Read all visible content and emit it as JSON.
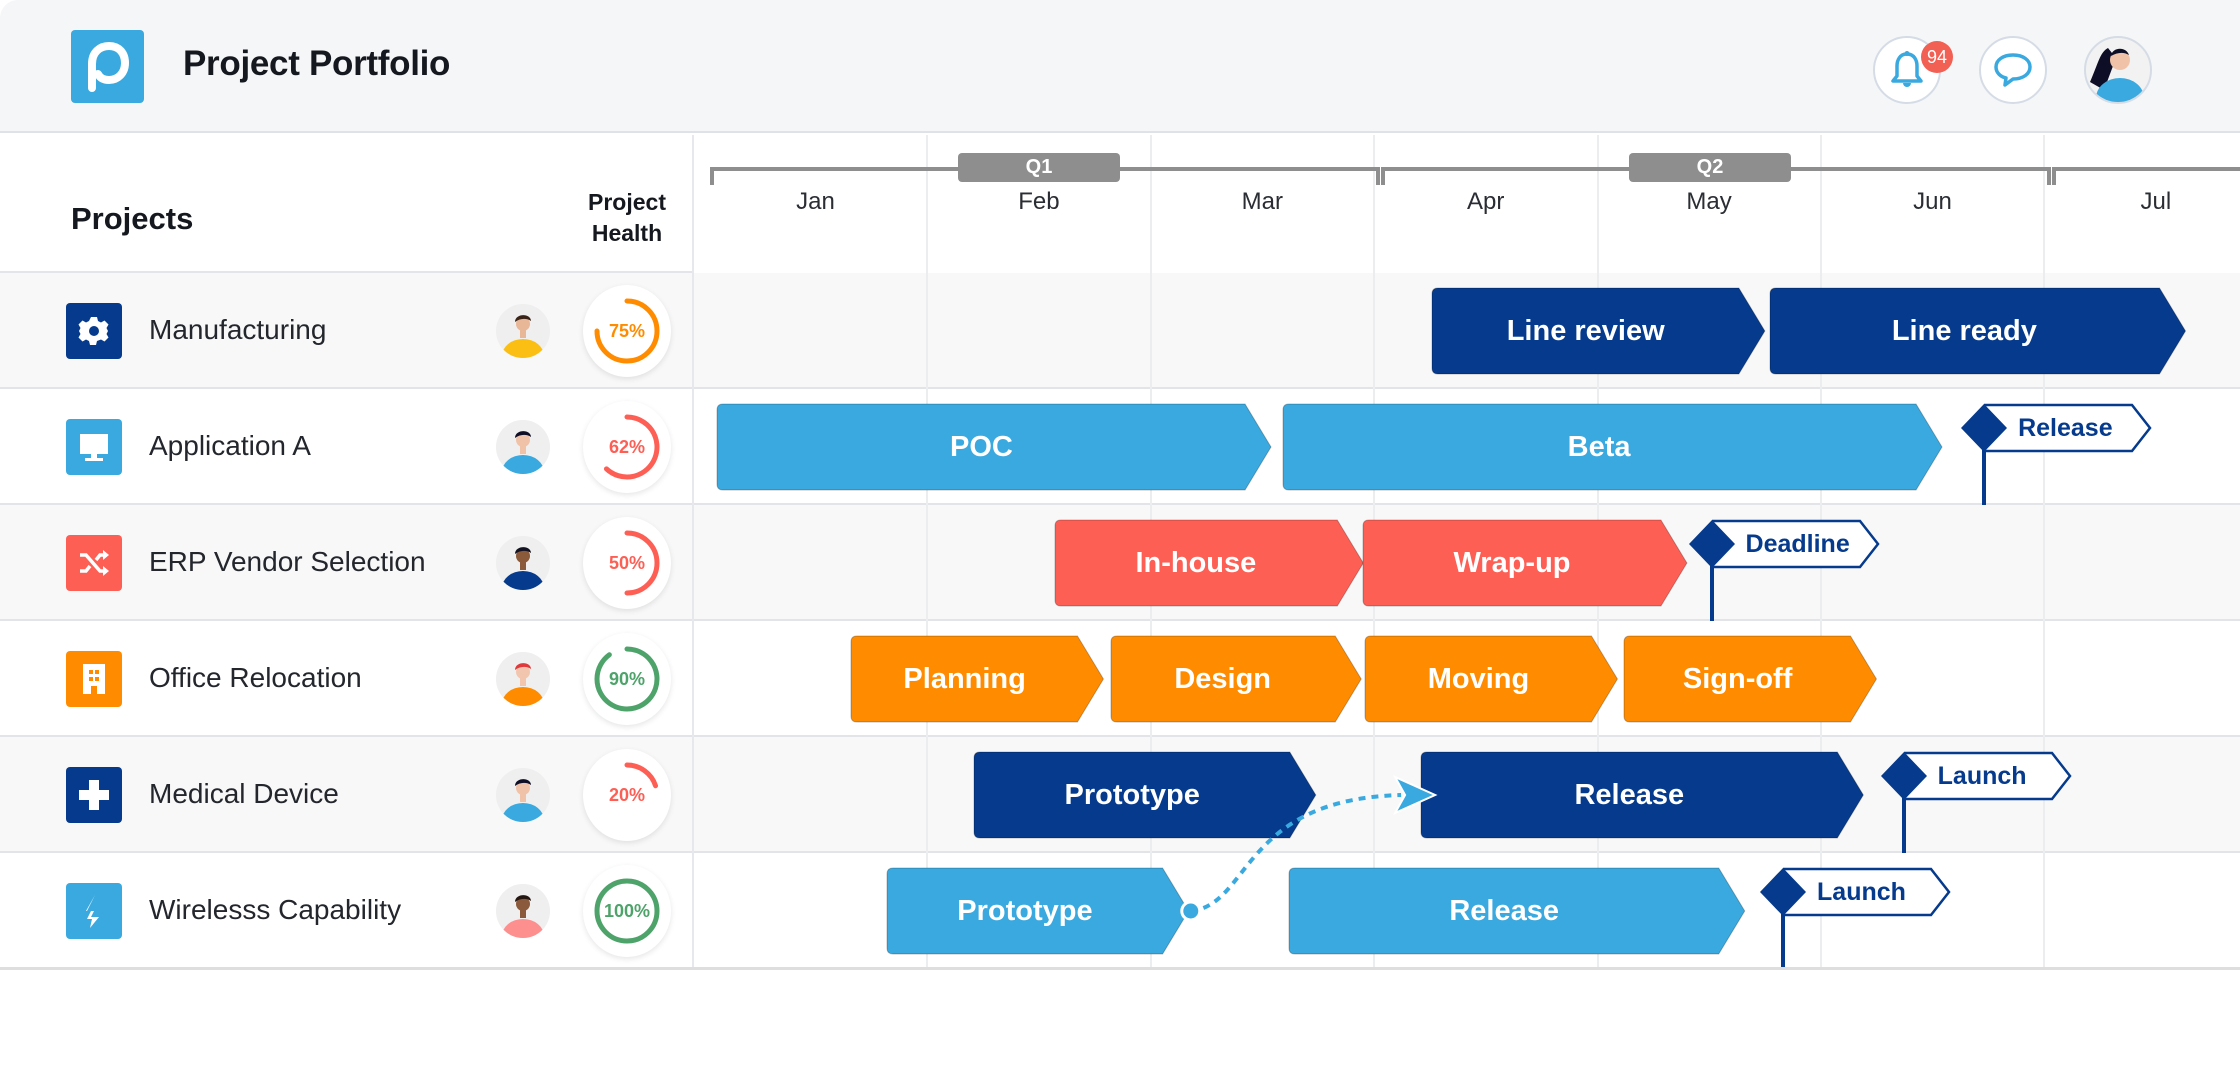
{
  "header": {
    "app_title": "Project Portfolio",
    "logo_letter": "p",
    "notifications_count": "94",
    "icons": {
      "logo": "portfolio-logo-icon",
      "notifications": "bell-icon",
      "messages": "chat-bubble-icon",
      "user": "user-avatar"
    }
  },
  "columns": {
    "projects_label": "Projects",
    "health_label_line1": "Project",
    "health_label_line2": "Health"
  },
  "timeline": {
    "quarters": [
      {
        "label": "Q1"
      },
      {
        "label": "Q2"
      }
    ],
    "months": [
      "Jan",
      "Feb",
      "Mar",
      "Apr",
      "May",
      "Jun",
      "Jul"
    ]
  },
  "colors": {
    "navy": "#053a8c",
    "sky": "#39a9df",
    "coral": "#fe5f55",
    "orange": "#ff8c00",
    "green": "#4ea36a",
    "quarter_gray": "#8e8e8e"
  },
  "projects": [
    {
      "name": "Manufacturing",
      "icon": "gear-icon",
      "icon_color": "#053a8c",
      "owner_shirt": "#fbbf14",
      "owner_hair": "#3a2418",
      "owner_skin": "#e8b797",
      "health": "75%",
      "health_value": 0.75,
      "health_color": "#ff8c00",
      "tasks": [
        {
          "label": "Line review",
          "start": 3.26,
          "end": 4.75,
          "color": "#053a8c"
        },
        {
          "label": "Line ready",
          "start": 4.77,
          "end": 6.63,
          "color": "#053a8c"
        }
      ],
      "milestones": []
    },
    {
      "name": "Application A",
      "icon": "monitor-icon",
      "icon_color": "#39a9df",
      "owner_shirt": "#39a9df",
      "owner_hair": "#0e0e26",
      "owner_skin": "#f0c3a8",
      "health": "62%",
      "health_value": 0.62,
      "health_color": "#fe5f55",
      "tasks": [
        {
          "label": "POC",
          "start": 0.06,
          "end": 2.54,
          "color": "#39a9df"
        },
        {
          "label": "Beta",
          "start": 2.59,
          "end": 5.54,
          "color": "#39a9df"
        }
      ],
      "milestones": [
        {
          "label": "Release",
          "at": 5.73
        }
      ]
    },
    {
      "name": "ERP Vendor Selection",
      "icon": "shuffle-icon",
      "icon_color": "#fe5f55",
      "owner_shirt": "#053a8c",
      "owner_hair": "#111122",
      "owner_skin": "#8a5a3a",
      "health": "50%",
      "health_value": 0.5,
      "health_color": "#fe5f55",
      "tasks": [
        {
          "label": "In-house",
          "start": 1.57,
          "end": 2.95,
          "color": "#fe5f55"
        },
        {
          "label": "Wrap-up",
          "start": 2.95,
          "end": 4.4,
          "color": "#fe5f55"
        }
      ],
      "milestones": [
        {
          "label": "Deadline",
          "at": 4.51
        }
      ]
    },
    {
      "name": "Office Relocation",
      "icon": "building-icon",
      "icon_color": "#ff8c00",
      "owner_shirt": "#ff8c00",
      "owner_hair": "#e0393b",
      "owner_skin": "#f2c6ae",
      "health": "90%",
      "health_value": 0.9,
      "health_color": "#4ea36a",
      "tasks": [
        {
          "label": "Planning",
          "start": 0.66,
          "end": 1.79,
          "color": "#ff8c00"
        },
        {
          "label": "Design",
          "start": 1.82,
          "end": 2.94,
          "color": "#ff8c00"
        },
        {
          "label": "Moving",
          "start": 2.96,
          "end": 4.09,
          "color": "#ff8c00"
        },
        {
          "label": "Sign-off",
          "start": 4.12,
          "end": 5.25,
          "color": "#ff8c00"
        }
      ],
      "milestones": []
    },
    {
      "name": "Medical Device",
      "icon": "plus-cross-icon",
      "icon_color": "#053a8c",
      "owner_shirt": "#39a9df",
      "owner_hair": "#0e0e26",
      "owner_skin": "#f0c3a8",
      "health": "20%",
      "health_value": 0.2,
      "health_color": "#fe5f55",
      "tasks": [
        {
          "label": "Prototype",
          "start": 1.21,
          "end": 2.74,
          "color": "#053a8c"
        },
        {
          "label": "Release",
          "start": 3.21,
          "end": 5.19,
          "color": "#053a8c"
        }
      ],
      "milestones": [
        {
          "label": "Launch",
          "at": 5.37
        }
      ]
    },
    {
      "name": "Wirelesss Capability",
      "icon": "lightning-icon",
      "icon_color": "#39a9df",
      "owner_shirt": "#fe8f8f",
      "owner_hair": "#241611",
      "owner_skin": "#8b5a3c",
      "health": "100%",
      "health_value": 1.0,
      "health_color": "#4ea36a",
      "tasks": [
        {
          "label": "Prototype",
          "start": 0.82,
          "end": 2.17,
          "color": "#39a9df"
        },
        {
          "label": "Release",
          "start": 2.62,
          "end": 4.66,
          "color": "#39a9df"
        }
      ],
      "milestones": [
        {
          "label": "Launch",
          "at": 4.83
        }
      ]
    }
  ],
  "dependencies": [
    {
      "from_project": 5,
      "from_task": 0,
      "to_project": 4,
      "to_task": 1
    }
  ]
}
